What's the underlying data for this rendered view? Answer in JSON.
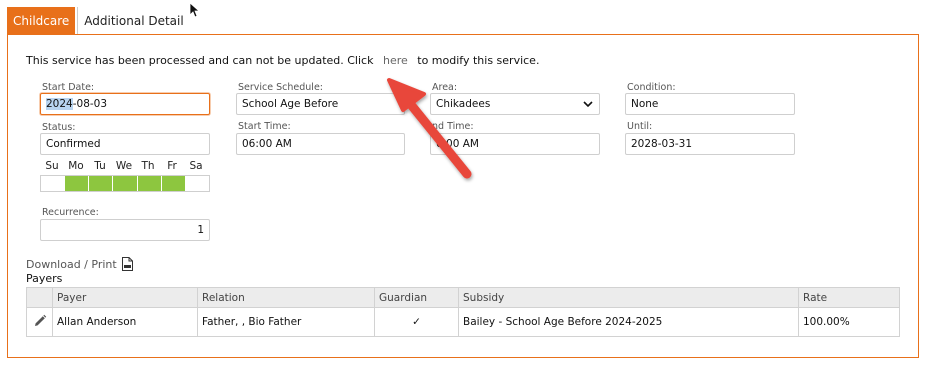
{
  "tabs": [
    {
      "label": "Childcare",
      "active": true
    },
    {
      "label": "Additional Detail",
      "active": false
    }
  ],
  "notice": {
    "before": "This service has been processed and can not be updated. Click",
    "link": "here",
    "after": "to modify this service."
  },
  "form": {
    "start_date": {
      "label": "Start Date:",
      "selected": "2024",
      "rest": "-08-03"
    },
    "service_schedule": {
      "label": "Service Schedule:",
      "value": "School Age Before"
    },
    "area": {
      "label": "Area:",
      "value": "Chikadees"
    },
    "condition": {
      "label": "Condition:",
      "value": "None"
    },
    "status": {
      "label": "Status:",
      "value": "Confirmed"
    },
    "start_time": {
      "label": "Start Time:",
      "value": "06:00 AM"
    },
    "end_time": {
      "label": "End Time:",
      "visible_label": "nd Time:",
      "visible_value": "0   00 AM"
    },
    "until": {
      "label": "Until:",
      "value": "2028-03-31"
    },
    "recurrence": {
      "label": "Recurrence:",
      "value": "1"
    }
  },
  "days": {
    "labels": [
      "Su",
      "Mo",
      "Tu",
      "We",
      "Th",
      "Fr",
      "Sa"
    ],
    "active": [
      false,
      true,
      true,
      true,
      true,
      true,
      false
    ],
    "active_color": "#8dc63f"
  },
  "download": {
    "label": "Download / Print",
    "icon": "pdf-icon"
  },
  "payers": {
    "title": "Payers",
    "columns": [
      "",
      "Payer",
      "Relation",
      "Guardian",
      "Subsidy",
      "Rate"
    ],
    "rows": [
      {
        "payer": "Allan Anderson",
        "relation": "Father, , Bio Father",
        "guardian": "✓",
        "subsidy": "Bailey - School Age Before 2024-2025",
        "rate": "100.00%"
      }
    ]
  },
  "colors": {
    "accent": "#e8701a",
    "annotation_arrow": "#e8473a"
  }
}
